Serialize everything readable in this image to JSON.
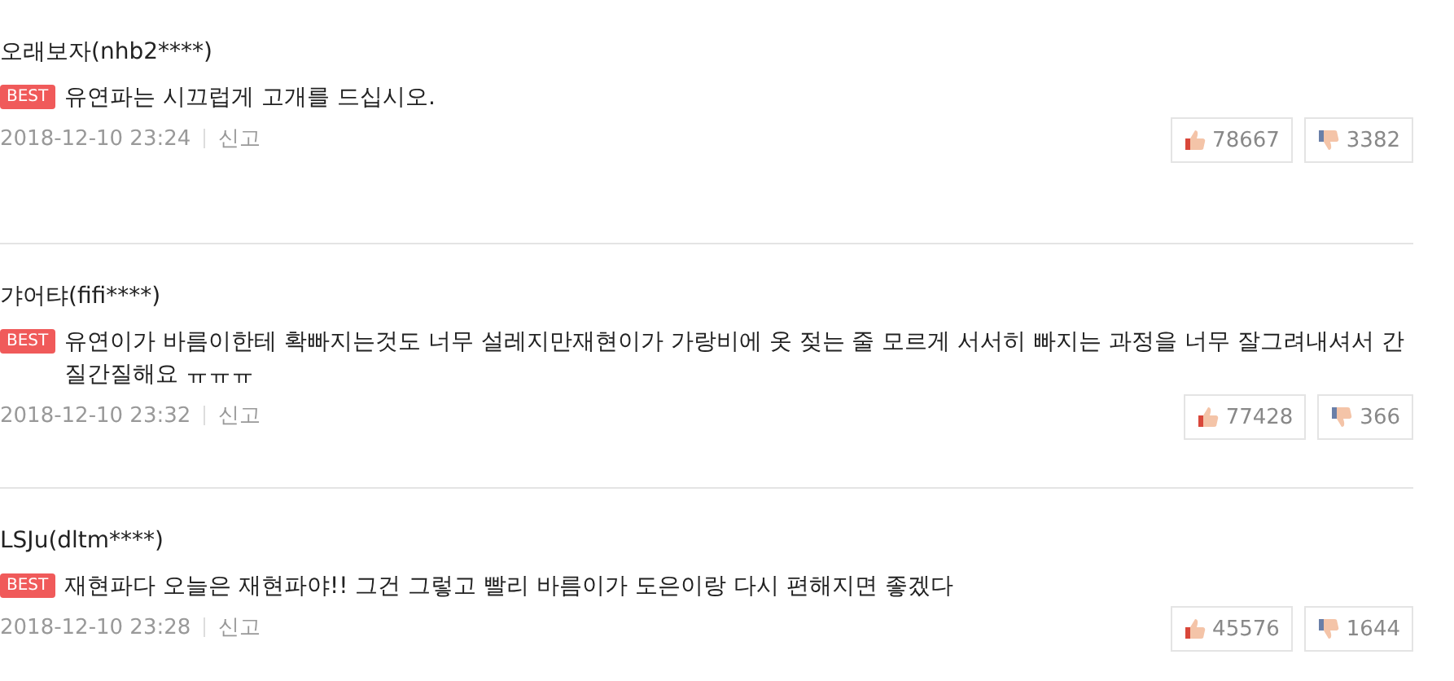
{
  "comments": [
    {
      "author": "오래보자(nhb2****)",
      "badge": "BEST",
      "text": "유연파는 시끄럽게 고개를 드십시오.",
      "date": "2018-12-10 23:24",
      "report": "신고",
      "likes": "78667",
      "dislikes": "3382"
    },
    {
      "author": "갸어탸(fifi****)",
      "badge": "BEST",
      "text": "유연이가 바름이한테 확빠지는것도 너무 설레지만재현이가 가랑비에 옷 젖는 줄 모르게 서서히 빠지는 과정을 너무 잘그려내셔서 간질간질해요 ㅠㅠㅠ",
      "date": "2018-12-10 23:32",
      "report": "신고",
      "likes": "77428",
      "dislikes": "366"
    },
    {
      "author": "LSJu(dltm****)",
      "badge": "BEST",
      "text": "재현파다 오늘은 재현파야!! 그건 그렇고 빨리 바름이가 도은이랑 다시 편해지면 좋겠다",
      "date": "2018-12-10 23:28",
      "report": "신고",
      "likes": "45576",
      "dislikes": "1644"
    }
  ]
}
